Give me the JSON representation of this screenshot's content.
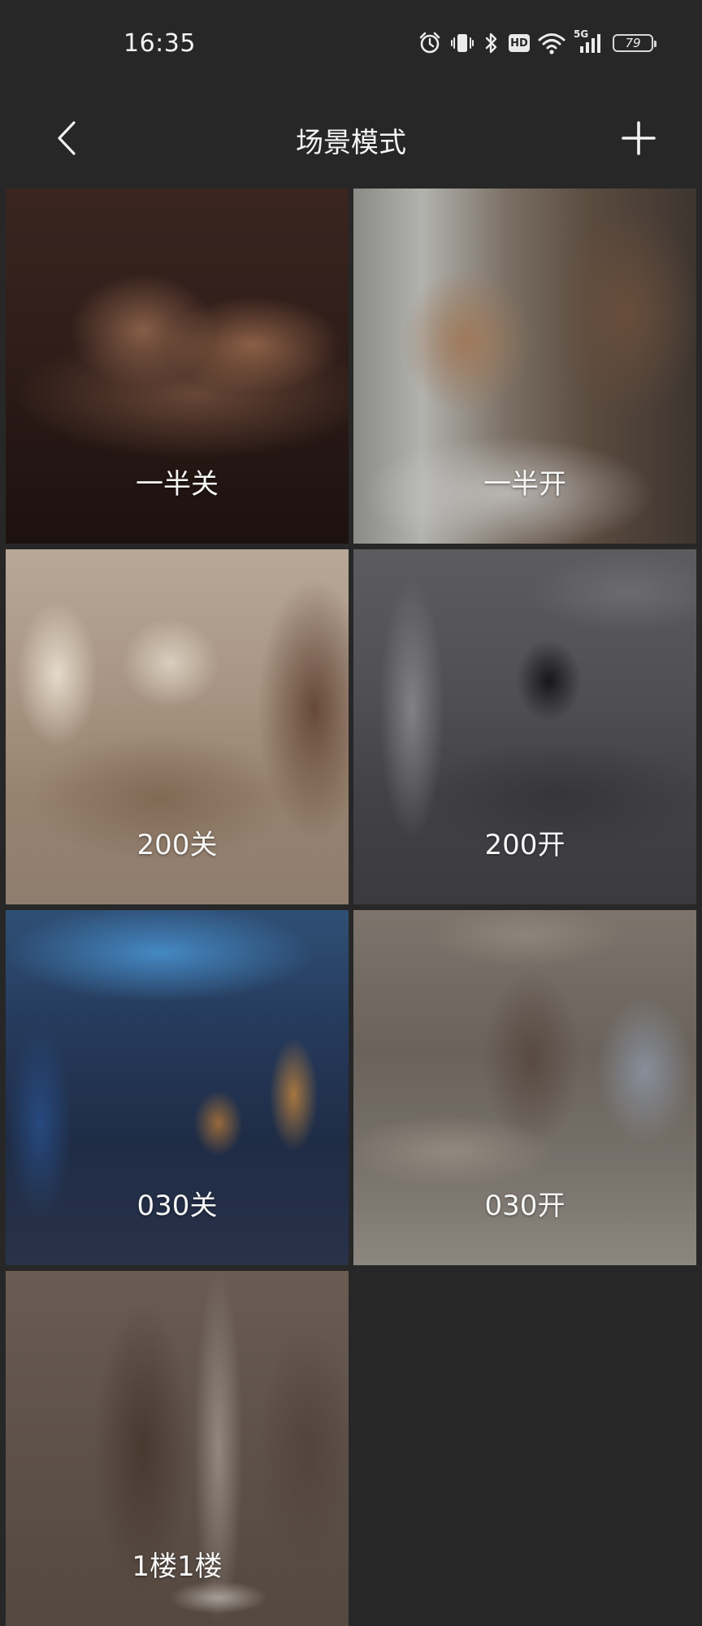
{
  "status_bar": {
    "time": "16:35",
    "icons": [
      "alarm-icon",
      "vibrate-icon",
      "bluetooth-icon",
      "hd-icon",
      "wifi-icon",
      "5g-signal-icon",
      "battery-icon"
    ],
    "hd_label": "HD",
    "network_label": "5G",
    "battery_level": "79"
  },
  "header": {
    "title": "场景模式",
    "back_icon": "chevron-left-icon",
    "add_icon": "plus-icon"
  },
  "scenes": [
    {
      "label": "一半关"
    },
    {
      "label": "一半开"
    },
    {
      "label": "200关"
    },
    {
      "label": "200开"
    },
    {
      "label": "030关"
    },
    {
      "label": "030开"
    },
    {
      "label": "1楼1楼"
    }
  ],
  "colors": {
    "background": "#272727",
    "text": "#f2f2f2"
  }
}
